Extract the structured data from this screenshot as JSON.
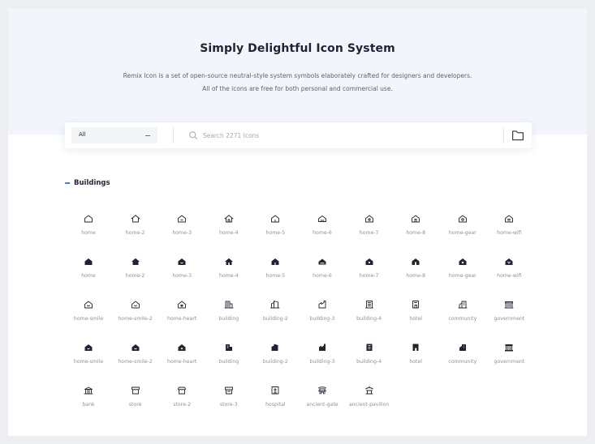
{
  "hero": {
    "title": "Simply Delightful Icon System",
    "desc_line1": "Remix Icon is a set of open-source neutral-style system symbols elaborately crafted for designers and developers.",
    "desc_line2": "All of the icons are free for both personal and commercial use."
  },
  "search": {
    "category_value": "All",
    "placeholder": "Search 2271 Icons",
    "value": "",
    "folder_icon": "folder-icon",
    "search_icon": "search-icon"
  },
  "section": {
    "label": "Buildings",
    "toggle_icon": "minus-icon"
  },
  "colors": {
    "accent": "#3b82f6",
    "icon": "#1f2433",
    "hero_bg": "#f2f6fc"
  },
  "icons": [
    {
      "name": "home",
      "icon": "home-line-icon"
    },
    {
      "name": "home-2",
      "icon": "home-2-line-icon"
    },
    {
      "name": "home-3",
      "icon": "home-3-line-icon"
    },
    {
      "name": "home-4",
      "icon": "home-4-line-icon"
    },
    {
      "name": "home-5",
      "icon": "home-5-line-icon"
    },
    {
      "name": "home-6",
      "icon": "home-6-line-icon"
    },
    {
      "name": "home-7",
      "icon": "home-7-line-icon"
    },
    {
      "name": "home-8",
      "icon": "home-8-line-icon"
    },
    {
      "name": "home-gear",
      "icon": "home-gear-line-icon"
    },
    {
      "name": "home-wifi",
      "icon": "home-wifi-line-icon"
    },
    {
      "name": "home",
      "icon": "home-fill-icon"
    },
    {
      "name": "home-2",
      "icon": "home-2-fill-icon"
    },
    {
      "name": "home-3",
      "icon": "home-3-fill-icon"
    },
    {
      "name": "home-4",
      "icon": "home-4-fill-icon"
    },
    {
      "name": "home-5",
      "icon": "home-5-fill-icon"
    },
    {
      "name": "home-6",
      "icon": "home-6-fill-icon"
    },
    {
      "name": "home-7",
      "icon": "home-7-fill-icon"
    },
    {
      "name": "home-8",
      "icon": "home-8-fill-icon"
    },
    {
      "name": "home-gear",
      "icon": "home-gear-fill-icon"
    },
    {
      "name": "home-wifi",
      "icon": "home-wifi-fill-icon"
    },
    {
      "name": "home-smile",
      "icon": "home-smile-line-icon"
    },
    {
      "name": "home-smile-2",
      "icon": "home-smile-2-line-icon"
    },
    {
      "name": "home-heart",
      "icon": "home-heart-line-icon"
    },
    {
      "name": "building",
      "icon": "building-line-icon"
    },
    {
      "name": "building-2",
      "icon": "building-2-line-icon"
    },
    {
      "name": "building-3",
      "icon": "building-3-line-icon"
    },
    {
      "name": "building-4",
      "icon": "building-4-line-icon"
    },
    {
      "name": "hotel",
      "icon": "hotel-line-icon"
    },
    {
      "name": "community",
      "icon": "community-line-icon"
    },
    {
      "name": "government",
      "icon": "government-line-icon"
    },
    {
      "name": "home-smile",
      "icon": "home-smile-fill-icon"
    },
    {
      "name": "home-smile-2",
      "icon": "home-smile-2-fill-icon"
    },
    {
      "name": "home-heart",
      "icon": "home-heart-fill-icon"
    },
    {
      "name": "building",
      "icon": "building-fill-icon"
    },
    {
      "name": "building-2",
      "icon": "building-2-fill-icon"
    },
    {
      "name": "building-3",
      "icon": "building-3-fill-icon"
    },
    {
      "name": "building-4",
      "icon": "building-4-fill-icon"
    },
    {
      "name": "hotel",
      "icon": "hotel-fill-icon"
    },
    {
      "name": "community",
      "icon": "community-fill-icon"
    },
    {
      "name": "government",
      "icon": "government-fill-icon"
    },
    {
      "name": "bank",
      "icon": "bank-line-icon"
    },
    {
      "name": "store",
      "icon": "store-line-icon"
    },
    {
      "name": "store-2",
      "icon": "store-2-line-icon"
    },
    {
      "name": "store-3",
      "icon": "store-3-line-icon"
    },
    {
      "name": "hospital",
      "icon": "hospital-line-icon"
    },
    {
      "name": "ancient-gate",
      "icon": "ancient-gate-line-icon"
    },
    {
      "name": "ancient-pavilion",
      "icon": "ancient-pavilion-line-icon"
    }
  ]
}
